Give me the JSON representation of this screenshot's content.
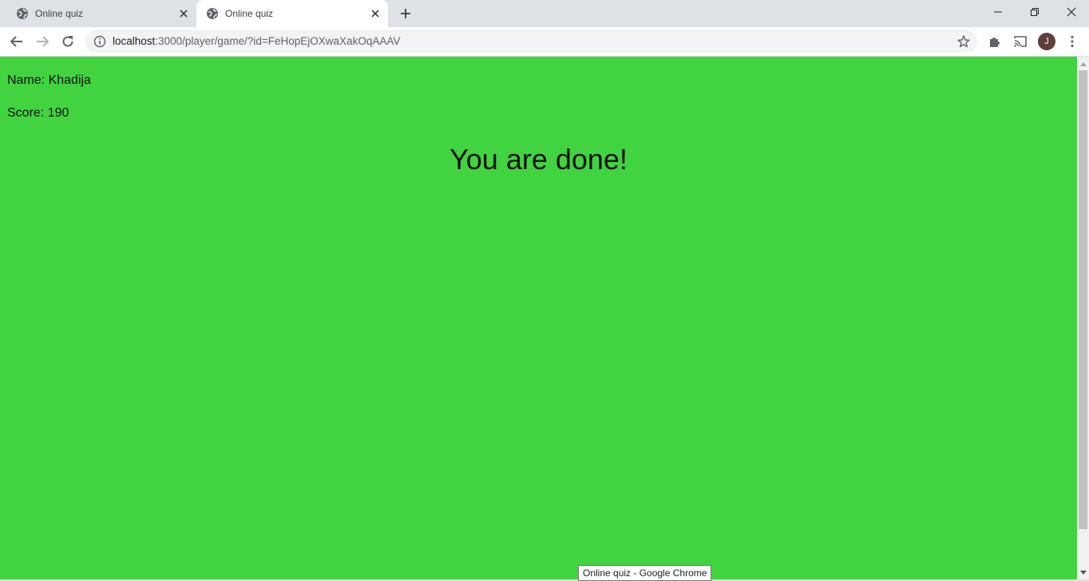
{
  "browser": {
    "tabs": [
      {
        "title": "Online quiz",
        "active": false
      },
      {
        "title": "Online quiz",
        "active": true
      }
    ],
    "address": {
      "host": "localhost",
      "path": ":3000/player/game/?id=FeHopEjOXwaXakOqAAAV"
    },
    "profile_initial": "J",
    "avatar_color": "#5d4037",
    "tooltip": "Online quiz - Google Chrome"
  },
  "page": {
    "background_color": "#42d340",
    "name_line": "Name: Khadija",
    "score_line": "Score: 190",
    "heading": "You are done!"
  }
}
